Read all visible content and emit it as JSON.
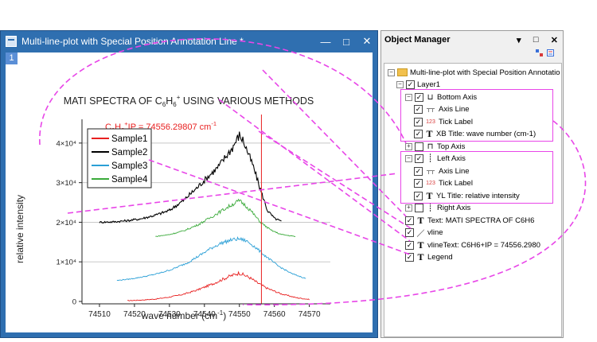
{
  "graph_window": {
    "title": "Multi-line-plot with Special Position Annotation Line *",
    "layer_badge": "1",
    "buttons": {
      "minimize": "—",
      "maximize": "□",
      "close": "✕"
    }
  },
  "object_manager": {
    "title": "Object Manager",
    "buttons": {
      "pin": "▾",
      "float": "□",
      "close": "✕"
    },
    "tree": [
      {
        "label": "Multi-line-plot with Special Position Annotatio",
        "icon": "folder-icon",
        "expander": "−",
        "checked": null,
        "indent": 0
      },
      {
        "label": "Layer1",
        "icon": "",
        "expander": "−",
        "checked": true,
        "indent": 1
      },
      {
        "label": "Bottom Axis",
        "icon": "bottom-axis-icon",
        "expander": "−",
        "checked": true,
        "indent": 2
      },
      {
        "label": "Axis Line",
        "icon": "axis-line-icon",
        "expander": "",
        "checked": true,
        "indent": 3
      },
      {
        "label": "Tick Label",
        "icon": "tick-label-icon",
        "expander": "",
        "checked": true,
        "indent": 3
      },
      {
        "label": "XB Title: wave number (cm-1)",
        "icon": "text-icon",
        "expander": "",
        "checked": true,
        "indent": 3
      },
      {
        "label": "Top Axis",
        "icon": "top-axis-icon",
        "expander": "+",
        "checked": false,
        "indent": 2
      },
      {
        "label": "Left Axis",
        "icon": "left-axis-icon",
        "expander": "−",
        "checked": true,
        "indent": 2
      },
      {
        "label": "Axis Line",
        "icon": "axis-line-icon",
        "expander": "",
        "checked": true,
        "indent": 3
      },
      {
        "label": "Tick Label",
        "icon": "tick-label-icon",
        "expander": "",
        "checked": true,
        "indent": 3
      },
      {
        "label": "YL Title: relative intensity",
        "icon": "text-icon",
        "expander": "",
        "checked": true,
        "indent": 3
      },
      {
        "label": "Right Axis",
        "icon": "right-axis-icon",
        "expander": "+",
        "checked": false,
        "indent": 2
      },
      {
        "label": "Text: MATI SPECTRA OF C6H6",
        "icon": "text-icon",
        "expander": "",
        "checked": true,
        "indent": 2
      },
      {
        "label": "vline",
        "icon": "line-icon",
        "expander": "",
        "checked": true,
        "indent": 2
      },
      {
        "label": "vlineText: C6H6+IP = 74556.2980",
        "icon": "text-icon",
        "expander": "",
        "checked": true,
        "indent": 2
      },
      {
        "label": "Legend",
        "icon": "text-icon",
        "expander": "",
        "checked": true,
        "indent": 2
      }
    ]
  },
  "colors": {
    "title_bar": "#2f6fb0",
    "highlight": "#e846e8",
    "vline": "#e82020",
    "sample1": "#e82020",
    "sample2": "#000000",
    "sample3": "#2a9fd6",
    "sample4": "#3aaa3a"
  },
  "chart_data": {
    "type": "line",
    "title": "MATI SPECTRA OF C6H6+ USING VARIOUS METHODS",
    "title_parts": {
      "pre": "MATI SPECTRA OF C",
      "sub1": "6",
      "mid": "H",
      "sub2": "6",
      "sup": "+",
      "post": " USING VARIOUS METHODS"
    },
    "xlabel": "wave number (cm-1)",
    "xlabel_parts": {
      "pre": "wave number (cm",
      "sup": "-1",
      "post": ")"
    },
    "ylabel": "relative intensity",
    "xlim": [
      74505,
      74576
    ],
    "ylim": [
      -600,
      46000
    ],
    "xticks": [
      74510,
      74520,
      74530,
      74540,
      74550,
      74560,
      74570
    ],
    "yticks": [
      {
        "value": 0,
        "label": "0"
      },
      {
        "value": 10000,
        "label": "1×10⁴"
      },
      {
        "value": 20000,
        "label": "2×10⁴"
      },
      {
        "value": 30000,
        "label": "3×10⁴"
      },
      {
        "value": 40000,
        "label": "4×10⁴"
      }
    ],
    "gridlines": "horizontal",
    "legend_placement": "top-left",
    "vline": {
      "x": 74556.29807,
      "label": "C6H6+IP = 74556.29807 cm-1",
      "label_parts": {
        "pre": "C",
        "sub1": "6",
        "mid": "H",
        "sub2": "6",
        "sup": "+",
        "post": "IP = 74556.29807 cm",
        "sup2": "-1"
      }
    },
    "series": [
      {
        "name": "Sample1",
        "x": [
          74518,
          74522,
          74526,
          74530,
          74534,
          74538,
          74542,
          74545,
          74547,
          74549,
          74550,
          74551,
          74553,
          74555,
          74558,
          74562,
          74566,
          74570
        ],
        "values": [
          200,
          350,
          600,
          1100,
          1800,
          2900,
          4300,
          5500,
          6300,
          6900,
          7200,
          6800,
          6000,
          4800,
          3300,
          1900,
          1000,
          500
        ]
      },
      {
        "name": "Sample2",
        "x": [
          74510,
          74514,
          74518,
          74522,
          74526,
          74530,
          74534,
          74538,
          74541,
          74544,
          74546,
          74548,
          74549,
          74550,
          74551,
          74552,
          74554,
          74556,
          74558,
          74560,
          74562
        ],
        "values": [
          20000,
          20100,
          20400,
          20900,
          21800,
          23000,
          25500,
          28800,
          31500,
          34000,
          36500,
          38800,
          40500,
          42000,
          40800,
          38600,
          34000,
          28300,
          23000,
          21000,
          20200
        ]
      },
      {
        "name": "Sample3",
        "x": [
          74515,
          74519,
          74523,
          74527,
          74531,
          74535,
          74539,
          74542,
          74545,
          74548,
          74550,
          74552,
          74554,
          74557,
          74561,
          74565,
          74569
        ],
        "values": [
          5300,
          5700,
          6300,
          7100,
          8200,
          9700,
          11800,
          13500,
          14800,
          15600,
          15800,
          15300,
          14100,
          11800,
          9000,
          7000,
          5800
        ]
      },
      {
        "name": "Sample4",
        "x": [
          74526,
          74530,
          74534,
          74538,
          74541,
          74544,
          74547,
          74549,
          74550,
          74551,
          74553,
          74556,
          74559,
          74562,
          74566
        ],
        "values": [
          16400,
          16900,
          17800,
          19300,
          20800,
          22400,
          24000,
          25000,
          25400,
          24800,
          23200,
          20000,
          18000,
          16900,
          16400
        ]
      }
    ]
  }
}
